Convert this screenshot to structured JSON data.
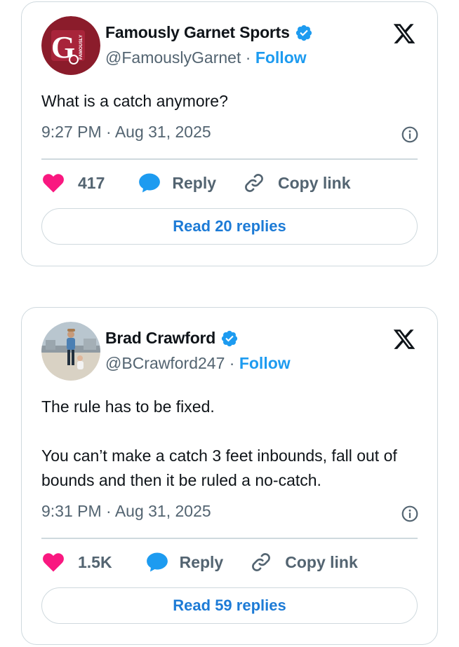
{
  "colors": {
    "accent": "#1d9bf0",
    "like": "#f91880",
    "muted": "#536471",
    "border": "#cfd9de",
    "team": "#8b1c2b"
  },
  "tweets": [
    {
      "author": "Famously Garnet Sports",
      "handle": "@FamouslyGarnet",
      "separator": "·",
      "follow": "Follow",
      "avatar": {
        "letters": "G",
        "side_text": "FAMOUSLY"
      },
      "text": "What is a catch anymore?",
      "timestamp": "9:27 PM · Aug 31, 2025",
      "likes": "417",
      "reply_label": "Reply",
      "copy_label": "Copy link",
      "read_replies": "Read 20 replies",
      "icons": [
        "verified-badge-icon",
        "x-logo-icon",
        "info-icon",
        "heart-icon",
        "reply-bubble-icon",
        "link-icon"
      ]
    },
    {
      "author": "Brad Crawford",
      "handle": "@BCrawford247",
      "separator": "·",
      "follow": "Follow",
      "text": "The rule has to be fixed.\n\nYou can’t make a catch 3 feet inbounds, fall out of bounds and then it be ruled a no-catch.",
      "timestamp": "9:31 PM · Aug 31, 2025",
      "likes": "1.5K",
      "reply_label": "Reply",
      "copy_label": "Copy link",
      "read_replies": "Read 59 replies",
      "icons": [
        "verified-badge-icon",
        "x-logo-icon",
        "info-icon",
        "heart-icon",
        "reply-bubble-icon",
        "link-icon"
      ]
    }
  ]
}
